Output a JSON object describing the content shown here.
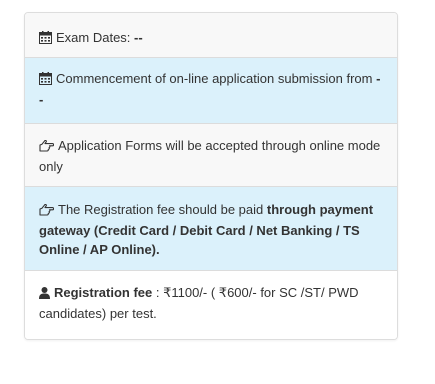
{
  "items": [
    {
      "icon": "calendar-icon",
      "text": "Exam Dates: ",
      "bold": "--"
    },
    {
      "icon": "calendar-icon",
      "text": "Commencement of on-line application submission from ",
      "bold": "--"
    },
    {
      "icon": "hand-pointing-right-icon",
      "text": "Application Forms will be accepted through online mode only"
    },
    {
      "icon": "hand-pointing-right-icon",
      "text": "The Registration fee should be paid ",
      "bold": "through payment gateway (Credit Card / Debit Card / Net Banking / TS Online / AP Online)."
    },
    {
      "icon": "user-icon",
      "bold": "Registration fee",
      "text": " : ₹1100/- ( ₹600/- for SC /ST/ PWD candidates) per test."
    }
  ],
  "colors": {
    "highlight": "#dbf1fb",
    "neutral": "#f8f8f8",
    "border": "#dddddd",
    "text": "#333333"
  }
}
